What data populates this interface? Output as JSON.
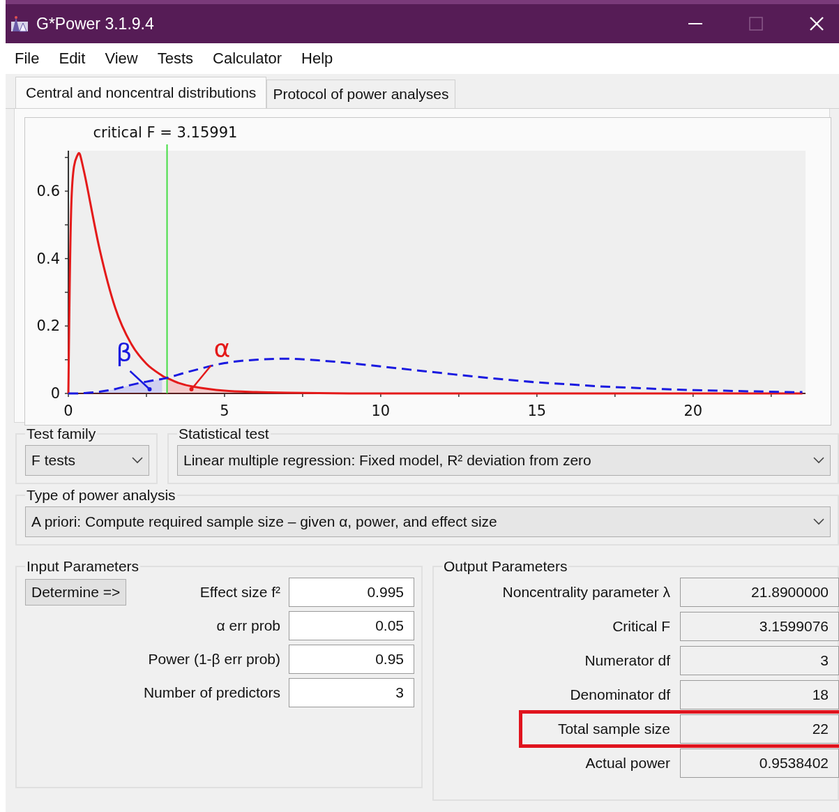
{
  "window": {
    "title": "G*Power 3.1.9.4"
  },
  "menu": [
    "File",
    "Edit",
    "View",
    "Tests",
    "Calculator",
    "Help"
  ],
  "tabs": [
    {
      "label": "Central and noncentral distributions",
      "selected": true
    },
    {
      "label": "Protocol of power analyses",
      "selected": false
    }
  ],
  "distribution_plot": {
    "chart_data": {
      "type": "line",
      "x": [
        0,
        0.1,
        0.3,
        0.5,
        1,
        1.5,
        2,
        2.5,
        3,
        3.16,
        3.5,
        4,
        5,
        6,
        7,
        8,
        9,
        10,
        11,
        12,
        13,
        14,
        15,
        16,
        17,
        18,
        19,
        20,
        21,
        22,
        23,
        23.5
      ],
      "series": [
        {
          "color": "#e41a1a",
          "line_style": "solid",
          "values": [
            0,
            0.574,
            0.708,
            0.659,
            0.428,
            0.254,
            0.149,
            0.088,
            0.053,
            0.046,
            0.032,
            0.02,
            0.008,
            0.004,
            0.002,
            0.001,
            0,
            0,
            0,
            0,
            0,
            0,
            0,
            0,
            0,
            0,
            0,
            0,
            0,
            0,
            0,
            0
          ]
        },
        {
          "color": "#1a1ae0",
          "line_style": "dashed",
          "values": [
            0,
            0,
            0,
            0.001,
            0.005,
            0.013,
            0.025,
            0.035,
            0.043,
            0.046,
            0.055,
            0.068,
            0.09,
            0.1,
            0.103,
            0.098,
            0.09,
            0.08,
            0.07,
            0.06,
            0.05,
            0.041,
            0.033,
            0.027,
            0.021,
            0.017,
            0.013,
            0.01,
            0.008,
            0.006,
            0.004,
            0.004
          ]
        }
      ],
      "xlim": [
        0,
        23.6
      ],
      "ylim": [
        0,
        0.72
      ],
      "xticks": [
        0,
        5,
        10,
        15,
        20
      ],
      "yticks": [
        0,
        0.2,
        0.4,
        0.6
      ],
      "ref_lines": [
        {
          "axis": "x",
          "value": 3.15991,
          "label": "critical F = 3.15991",
          "color": "#44dd44"
        }
      ],
      "annotations": [
        "β",
        "α"
      ]
    }
  },
  "test_family": {
    "label": "Test family",
    "value": "F tests"
  },
  "statistical_test": {
    "label": "Statistical test",
    "value": "Linear multiple regression: Fixed model, R² deviation from zero"
  },
  "power_analysis_type": {
    "label": "Type of power analysis",
    "value": "A priori: Compute required sample size – given α, power, and effect size"
  },
  "input_parameters": {
    "title": "Input Parameters",
    "determine_button": "Determine =>",
    "fields": [
      {
        "label": "Effect size f²",
        "value": "0.995"
      },
      {
        "label": "α err prob",
        "value": "0.05"
      },
      {
        "label": "Power (1-β err prob)",
        "value": "0.95"
      },
      {
        "label": "Number of predictors",
        "value": "3"
      }
    ]
  },
  "output_parameters": {
    "title": "Output Parameters",
    "fields": [
      {
        "label": "Noncentrality parameter λ",
        "value": "21.8900000",
        "highlighted": false
      },
      {
        "label": "Critical F",
        "value": "3.1599076",
        "highlighted": false
      },
      {
        "label": "Numerator df",
        "value": "3",
        "highlighted": false
      },
      {
        "label": "Denominator df",
        "value": "18",
        "highlighted": false
      },
      {
        "label": "Total sample size",
        "value": "22",
        "highlighted": true
      },
      {
        "label": "Actual power",
        "value": "0.9538402",
        "highlighted": false
      }
    ]
  }
}
